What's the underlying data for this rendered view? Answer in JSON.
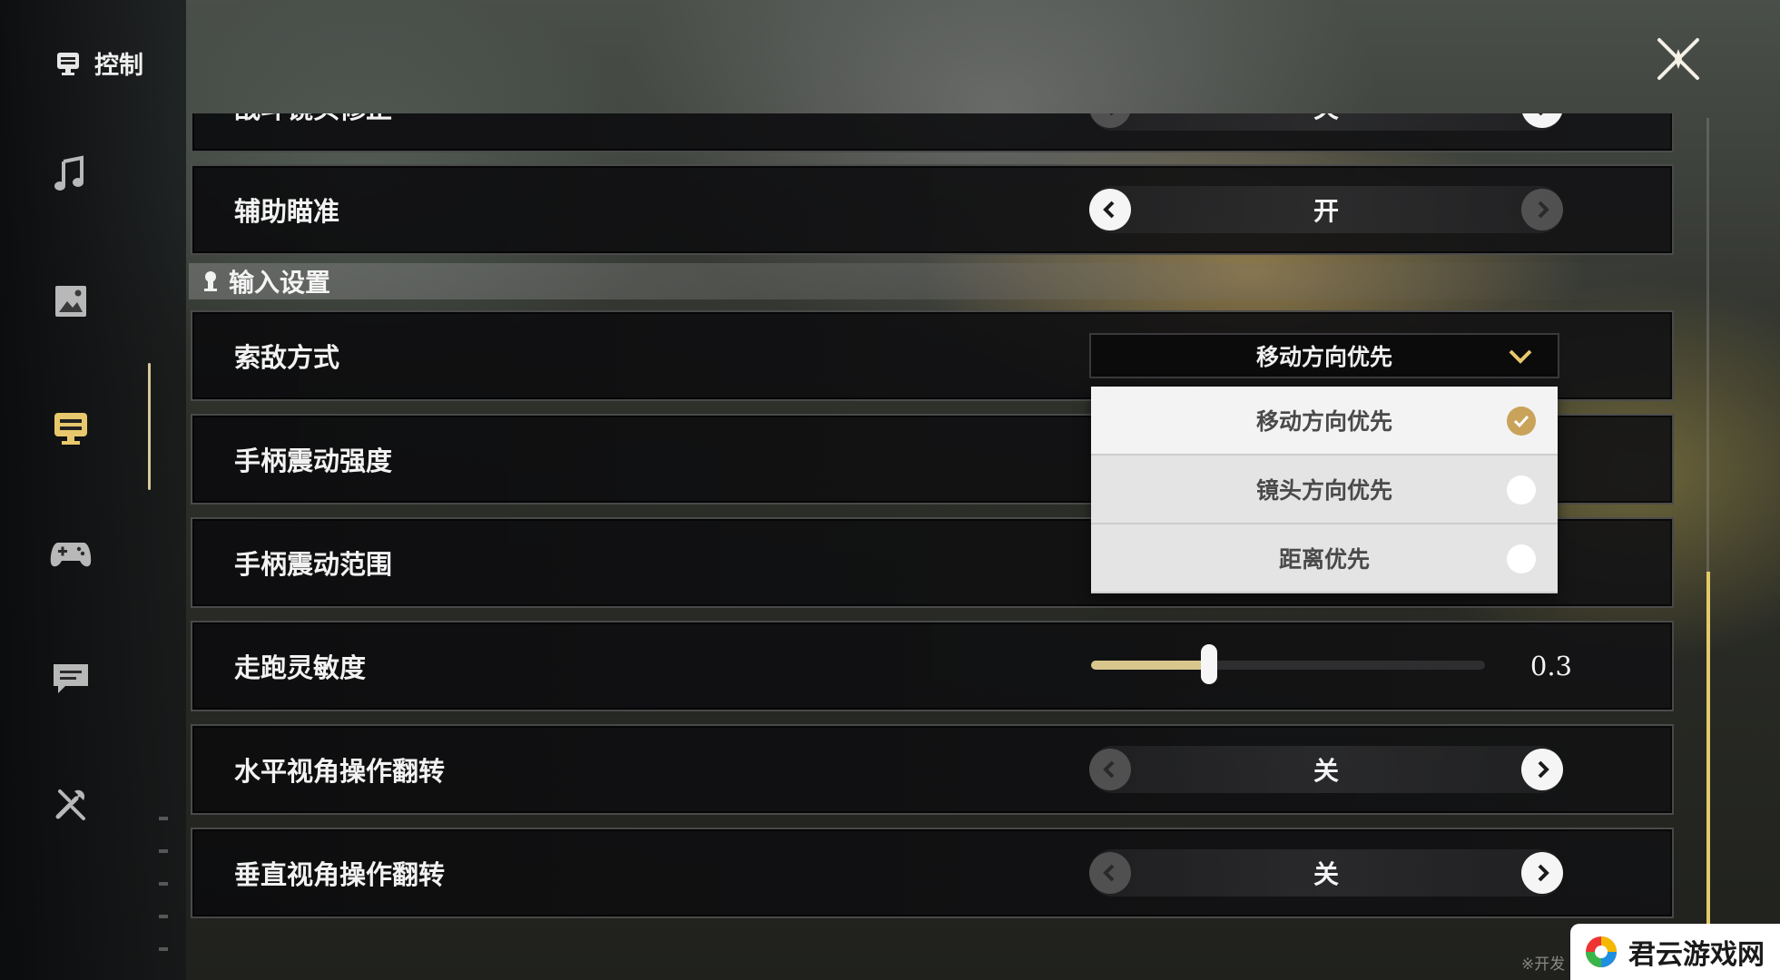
{
  "sidebar": {
    "title": "控制",
    "items": [
      {
        "icon": "music-note-icon",
        "active": false
      },
      {
        "icon": "image-icon",
        "active": false
      },
      {
        "icon": "control-icon",
        "active": true
      },
      {
        "icon": "gamepad-icon",
        "active": false
      },
      {
        "icon": "chat-bubble-icon",
        "active": false
      },
      {
        "icon": "tools-icon",
        "active": false
      }
    ]
  },
  "rows": {
    "partial": {
      "label": "战斗镜头修正",
      "value": "关"
    },
    "aim_assist": {
      "label": "辅助瞄准",
      "value": "开"
    },
    "target_mode": {
      "label": "索敌方式",
      "value": "移动方向优先"
    },
    "vibration_strength": {
      "label": "手柄震动强度"
    },
    "vibration_range": {
      "label": "手柄震动范围"
    },
    "run_sensitivity": {
      "label": "走跑灵敏度",
      "value": "0.3",
      "fraction": 0.3
    },
    "h_invert": {
      "label": "水平视角操作翻转",
      "value": "关"
    },
    "v_invert": {
      "label": "垂直视角操作翻转",
      "value": "关"
    }
  },
  "section": {
    "title": "输入设置"
  },
  "dropdown": {
    "options": [
      {
        "label": "移动方向优先",
        "selected": true
      },
      {
        "label": "镜头方向优先",
        "selected": false
      },
      {
        "label": "距离优先",
        "selected": false
      }
    ]
  },
  "footer": {
    "note": "※开发"
  },
  "watermark": {
    "text": "君云游戏网"
  },
  "colors": {
    "accent": "#e8c86c",
    "check": "#c9a35a"
  }
}
